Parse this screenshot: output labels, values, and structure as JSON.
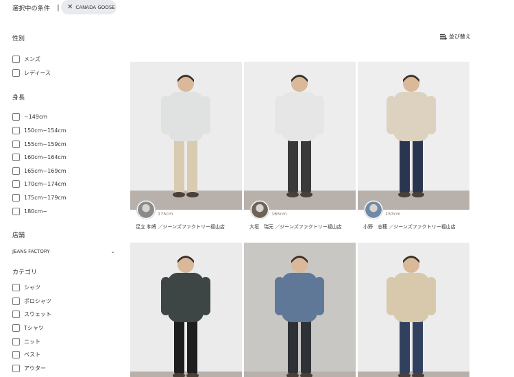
{
  "selected": {
    "label": "選択中の条件",
    "separator": "|",
    "chip_label": "CANADA GOOSE",
    "chip_close": "✕"
  },
  "sort": {
    "label": "並び替え"
  },
  "filters": {
    "gender": {
      "title": "性別",
      "options": [
        "メンズ",
        "レディース"
      ]
    },
    "height": {
      "title": "身長",
      "options": [
        "~149cm",
        "150cm~154cm",
        "155cm~159cm",
        "160cm~164cm",
        "165cm~169cm",
        "170cm~174cm",
        "175cm~179cm",
        "180cm~"
      ]
    },
    "store": {
      "title": "店舗",
      "selected": "JEANS FACTORY",
      "chevron": "⌄"
    },
    "category": {
      "title": "カテゴリ",
      "options": [
        "シャツ",
        "ポロシャツ",
        "スウェット",
        "Tシャツ",
        "ニット",
        "ベスト",
        "アウター"
      ]
    }
  },
  "posts": [
    {
      "height": "175cm",
      "name": "足立 和将 ／ジーンズファクトリー福山店",
      "wall": "#ececec",
      "jacket": "#dfe2e1",
      "pants": "#d8cbb0",
      "avatar": "#8a8a8a"
    },
    {
      "height": "165cm",
      "name": "大垣　瑞元 ／ジーンズファクトリー福山店",
      "wall": "#ededed",
      "jacket": "#e6e6e6",
      "pants": "#3a3a3a",
      "avatar": "#6d6359"
    },
    {
      "height": "153cm",
      "name": "小野　志穂 ／ジーンズファクトリー福山店",
      "wall": "#eeeeee",
      "jacket": "#dcd2bf",
      "pants": "#2a3550",
      "avatar": "#6f8aa6"
    },
    {
      "height": "",
      "name": "",
      "wall": "#ebebeb",
      "jacket": "#3e4545",
      "pants": "#1e1e1e",
      "avatar": "#999999"
    },
    {
      "height": "",
      "name": "",
      "wall": "#c9c7c4",
      "jacket": "#5f7898",
      "pants": "#2e3236",
      "avatar": "#999999"
    },
    {
      "height": "",
      "name": "",
      "wall": "#ececec",
      "jacket": "#d8c9ad",
      "pants": "#31405e",
      "avatar": "#999999"
    }
  ]
}
